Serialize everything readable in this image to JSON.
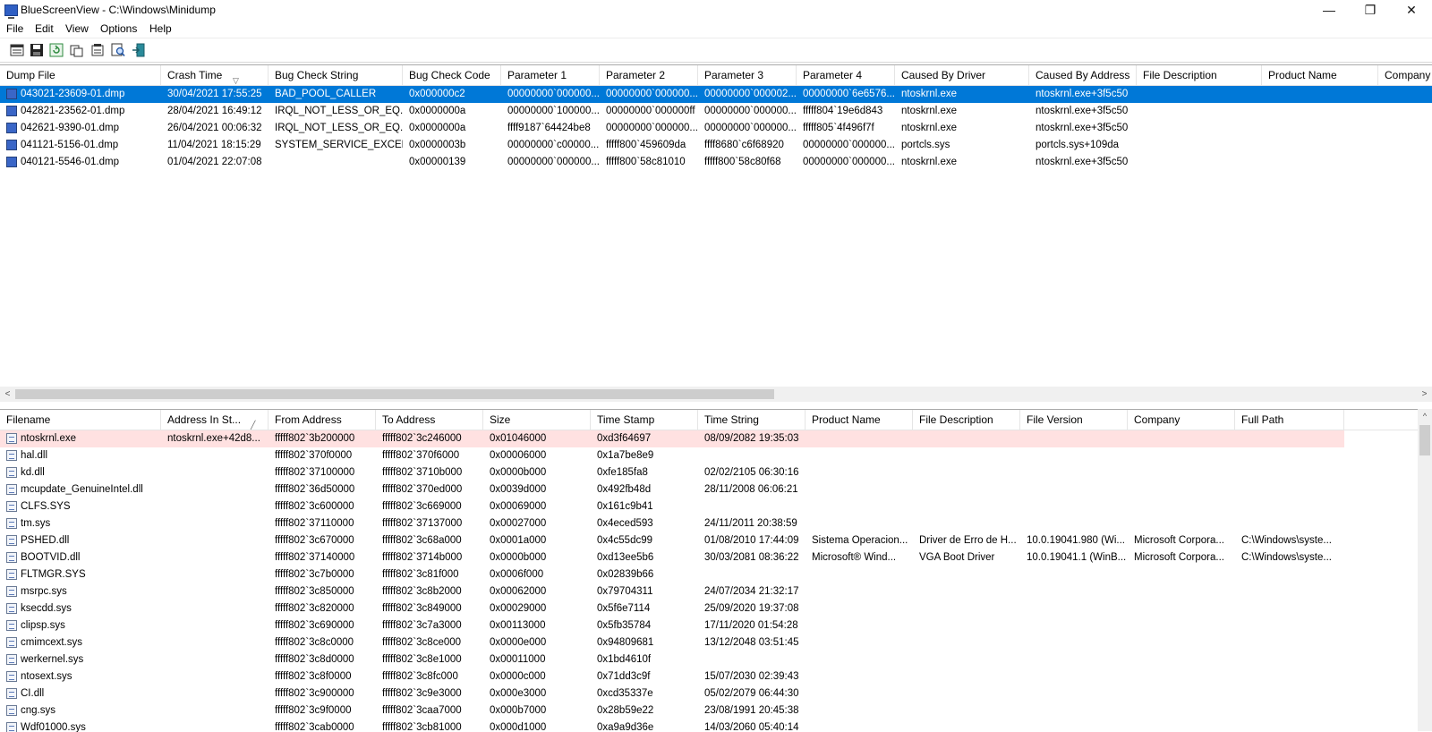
{
  "window": {
    "title": "BlueScreenView  -  C:\\Windows\\Minidump",
    "minimize_glyph": "—",
    "restore_glyph": "❐",
    "close_glyph": "✕"
  },
  "menu": [
    "File",
    "Edit",
    "View",
    "Options",
    "Help"
  ],
  "toolbar_icons": [
    "html-report-icon",
    "save-icon",
    "refresh-icon",
    "copy-icon",
    "properties-icon",
    "find-icon",
    "exit-icon"
  ],
  "upper_table": {
    "columns": [
      "Dump File",
      "Crash Time",
      "Bug Check String",
      "Bug Check Code",
      "Parameter 1",
      "Parameter 2",
      "Parameter 3",
      "Parameter 4",
      "Caused By Driver",
      "Caused By Address",
      "File Description",
      "Product Name",
      "Company"
    ],
    "rows": [
      [
        "043021-23609-01.dmp",
        "30/04/2021 17:55:25",
        "BAD_POOL_CALLER",
        "0x000000c2",
        "00000000`000000...",
        "00000000`000000...",
        "00000000`000002...",
        "00000000`6e6576...",
        "ntoskrnl.exe",
        "ntoskrnl.exe+3f5c50",
        "",
        "",
        ""
      ],
      [
        "042821-23562-01.dmp",
        "28/04/2021 16:49:12",
        "IRQL_NOT_LESS_OR_EQ...",
        "0x0000000a",
        "00000000`100000...",
        "00000000`000000ff",
        "00000000`000000...",
        "fffff804`19e6d843",
        "ntoskrnl.exe",
        "ntoskrnl.exe+3f5c50",
        "",
        "",
        ""
      ],
      [
        "042621-9390-01.dmp",
        "26/04/2021 00:06:32",
        "IRQL_NOT_LESS_OR_EQ...",
        "0x0000000a",
        "ffff9187`64424be8",
        "00000000`000000...",
        "00000000`000000...",
        "fffff805`4f496f7f",
        "ntoskrnl.exe",
        "ntoskrnl.exe+3f5c50",
        "",
        "",
        ""
      ],
      [
        "041121-5156-01.dmp",
        "11/04/2021 18:15:29",
        "SYSTEM_SERVICE_EXCEP...",
        "0x0000003b",
        "00000000`c00000...",
        "fffff800`459609da",
        "ffff8680`c6f68920",
        "00000000`000000...",
        "portcls.sys",
        "portcls.sys+109da",
        "",
        "",
        ""
      ],
      [
        "040121-5546-01.dmp",
        "01/04/2021 22:07:08",
        "",
        "0x00000139",
        "00000000`000000...",
        "fffff800`58c81010",
        "fffff800`58c80f68",
        "00000000`000000...",
        "ntoskrnl.exe",
        "ntoskrnl.exe+3f5c50",
        "",
        "",
        ""
      ]
    ]
  },
  "lower_table": {
    "columns": [
      "Filename",
      "Address In St...",
      "From Address",
      "To Address",
      "Size",
      "Time Stamp",
      "Time String",
      "Product Name",
      "File Description",
      "File Version",
      "Company",
      "Full Path"
    ],
    "rows": [
      [
        "ntoskrnl.exe",
        "ntoskrnl.exe+42d8...",
        "fffff802`3b200000",
        "fffff802`3c246000",
        "0x01046000",
        "0xd3f64697",
        "08/09/2082 19:35:03",
        "",
        "",
        "",
        "",
        ""
      ],
      [
        "hal.dll",
        "",
        "fffff802`370f0000",
        "fffff802`370f6000",
        "0x00006000",
        "0x1a7be8e9",
        "",
        "",
        "",
        "",
        "",
        ""
      ],
      [
        "kd.dll",
        "",
        "fffff802`37100000",
        "fffff802`3710b000",
        "0x0000b000",
        "0xfe185fa8",
        "02/02/2105 06:30:16",
        "",
        "",
        "",
        "",
        ""
      ],
      [
        "mcupdate_GenuineIntel.dll",
        "",
        "fffff802`36d50000",
        "fffff802`370ed000",
        "0x0039d000",
        "0x492fb48d",
        "28/11/2008 06:06:21",
        "",
        "",
        "",
        "",
        ""
      ],
      [
        "CLFS.SYS",
        "",
        "fffff802`3c600000",
        "fffff802`3c669000",
        "0x00069000",
        "0x161c9b41",
        "",
        "",
        "",
        "",
        "",
        ""
      ],
      [
        "tm.sys",
        "",
        "fffff802`37110000",
        "fffff802`37137000",
        "0x00027000",
        "0x4eced593",
        "24/11/2011 20:38:59",
        "",
        "",
        "",
        "",
        ""
      ],
      [
        "PSHED.dll",
        "",
        "fffff802`3c670000",
        "fffff802`3c68a000",
        "0x0001a000",
        "0x4c55dc99",
        "01/08/2010 17:44:09",
        "Sistema Operacion...",
        "Driver de Erro de H...",
        "10.0.19041.980 (Wi...",
        "Microsoft Corpora...",
        "C:\\Windows\\syste..."
      ],
      [
        "BOOTVID.dll",
        "",
        "fffff802`37140000",
        "fffff802`3714b000",
        "0x0000b000",
        "0xd13ee5b6",
        "30/03/2081 08:36:22",
        "Microsoft® Wind...",
        "VGA Boot Driver",
        "10.0.19041.1 (WinB...",
        "Microsoft Corpora...",
        "C:\\Windows\\syste..."
      ],
      [
        "FLTMGR.SYS",
        "",
        "fffff802`3c7b0000",
        "fffff802`3c81f000",
        "0x0006f000",
        "0x02839b66",
        "",
        "",
        "",
        "",
        "",
        ""
      ],
      [
        "msrpc.sys",
        "",
        "fffff802`3c850000",
        "fffff802`3c8b2000",
        "0x00062000",
        "0x79704311",
        "24/07/2034 21:32:17",
        "",
        "",
        "",
        "",
        ""
      ],
      [
        "ksecdd.sys",
        "",
        "fffff802`3c820000",
        "fffff802`3c849000",
        "0x00029000",
        "0x5f6e7114",
        "25/09/2020 19:37:08",
        "",
        "",
        "",
        "",
        ""
      ],
      [
        "clipsp.sys",
        "",
        "fffff802`3c690000",
        "fffff802`3c7a3000",
        "0x00113000",
        "0x5fb35784",
        "17/11/2020 01:54:28",
        "",
        "",
        "",
        "",
        ""
      ],
      [
        "cmimcext.sys",
        "",
        "fffff802`3c8c0000",
        "fffff802`3c8ce000",
        "0x0000e000",
        "0x94809681",
        "13/12/2048 03:51:45",
        "",
        "",
        "",
        "",
        ""
      ],
      [
        "werkernel.sys",
        "",
        "fffff802`3c8d0000",
        "fffff802`3c8e1000",
        "0x00011000",
        "0x1bd4610f",
        "",
        "",
        "",
        "",
        "",
        ""
      ],
      [
        "ntosext.sys",
        "",
        "fffff802`3c8f0000",
        "fffff802`3c8fc000",
        "0x0000c000",
        "0x71dd3c9f",
        "15/07/2030 02:39:43",
        "",
        "",
        "",
        "",
        ""
      ],
      [
        "CI.dll",
        "",
        "fffff802`3c900000",
        "fffff802`3c9e3000",
        "0x000e3000",
        "0xcd35337e",
        "05/02/2079 06:44:30",
        "",
        "",
        "",
        "",
        ""
      ],
      [
        "cng.sys",
        "",
        "fffff802`3c9f0000",
        "fffff802`3caa7000",
        "0x000b7000",
        "0x28b59e22",
        "23/08/1991 20:45:38",
        "",
        "",
        "",
        "",
        ""
      ],
      [
        "Wdf01000.sys",
        "",
        "fffff802`3cab0000",
        "fffff802`3cb81000",
        "0x000d1000",
        "0xa9a9d36e",
        "14/03/2060 05:40:14",
        "",
        "",
        "",
        "",
        ""
      ]
    ]
  },
  "scroll_arrows": {
    "left": "<",
    "right": ">",
    "up": "^",
    "down": "v"
  },
  "colors": {
    "selection": "#0078d7",
    "highlight_row": "#ffe1e1"
  }
}
